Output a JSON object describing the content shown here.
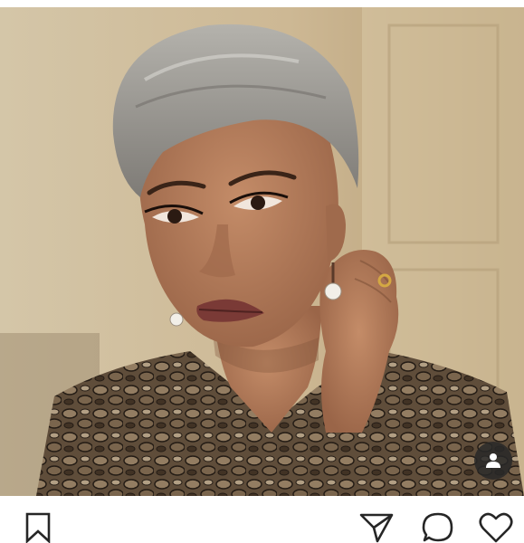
{
  "post": {
    "image": {
      "subject": "portrait-photo",
      "colors": {
        "background": "#d9c9a8",
        "hair": "#9a9894",
        "skin": "#b27c5c",
        "lips": "#7a3a36",
        "blouse": "#6e5a45"
      }
    },
    "overlay": {
      "tag_icon": "person-icon",
      "badge_color": "#2a2a2a"
    },
    "actions": {
      "save_icon": "bookmark-icon",
      "share_icon": "send-icon",
      "comment_icon": "comment-icon",
      "like_icon": "heart-icon",
      "icon_color": "#262626"
    }
  }
}
